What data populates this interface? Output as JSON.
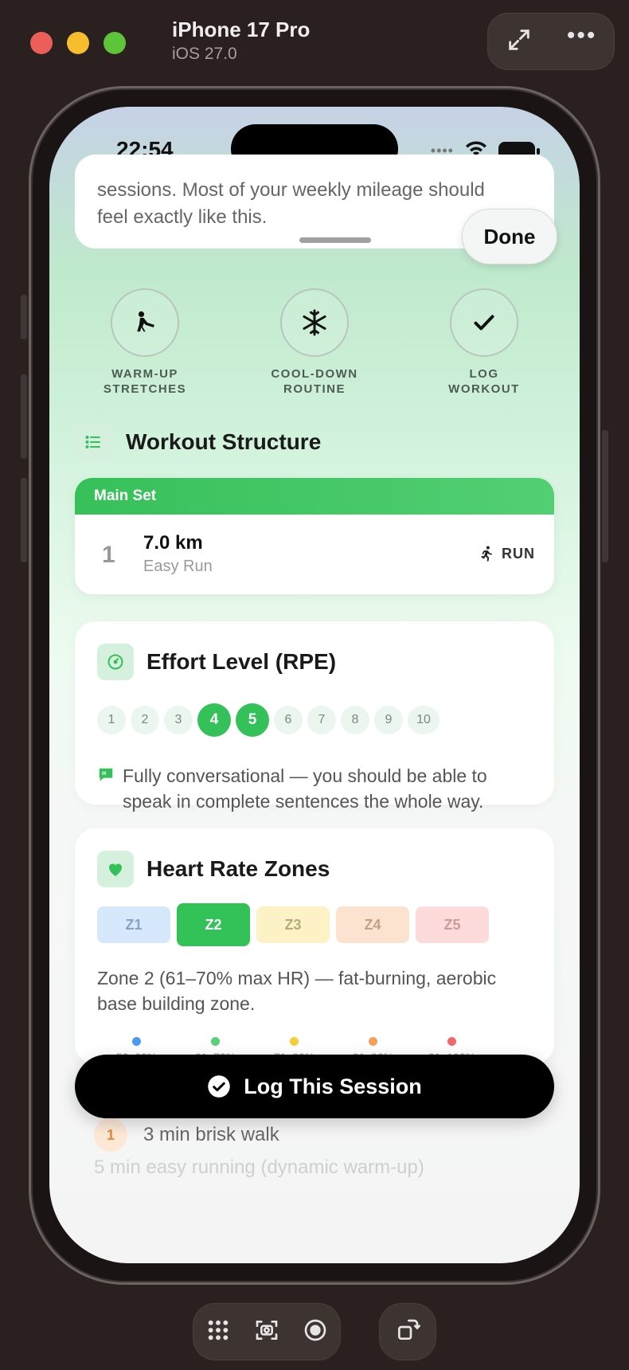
{
  "window": {
    "device_name": "iPhone 17 Pro",
    "os_version": "iOS 27.0"
  },
  "status_bar": {
    "time": "22:54"
  },
  "note_card": {
    "line1": "sessions. Most of your weekly mileage should",
    "line2": "feel exactly like this.",
    "done_label": "Done"
  },
  "quick_actions": [
    {
      "line1": "WARM-UP",
      "line2": "STRETCHES",
      "icon": "stretch-icon"
    },
    {
      "line1": "COOL-DOWN",
      "line2": "ROUTINE",
      "icon": "snowflake-icon"
    },
    {
      "line1": "LOG",
      "line2": "WORKOUT",
      "icon": "checkmark-icon"
    }
  ],
  "workout_structure": {
    "title": "Workout Structure",
    "main_set": {
      "label": "Main Set",
      "number": "1",
      "distance": "7.0 km",
      "type": "Easy Run",
      "tag": "RUN"
    }
  },
  "effort": {
    "title": "Effort Level (RPE)",
    "levels": [
      "1",
      "2",
      "3",
      "4",
      "5",
      "6",
      "7",
      "8",
      "9",
      "10"
    ],
    "active": [
      "4",
      "5"
    ],
    "note": "Fully conversational — you should be able to speak in complete sentences the whole way."
  },
  "heart_rate": {
    "title": "Heart Rate Zones",
    "zones": [
      "Z1",
      "Z2",
      "Z3",
      "Z4",
      "Z5"
    ],
    "active_zone": "Z2",
    "description": "Zone 2 (61–70% max HR) — fat-burning, aerobic base building zone.",
    "legend": [
      {
        "range": "50–60%",
        "color": "#4a9af5"
      },
      {
        "range": "61–70%",
        "color": "#5ccf7a"
      },
      {
        "range": "71–80%",
        "color": "#f5cf3a"
      },
      {
        "range": "81–90%",
        "color": "#f5a05a"
      },
      {
        "range": "91–100%",
        "color": "#f06a6a"
      }
    ]
  },
  "log_button": {
    "label": "Log This Session"
  },
  "warmup_list": {
    "item1_num": "1",
    "item1_text": "3 min brisk walk",
    "item2_text": "5 min easy running (dynamic warm-up)"
  },
  "colors": {
    "accent_green": "#34c15a",
    "background": "#2a201f"
  }
}
